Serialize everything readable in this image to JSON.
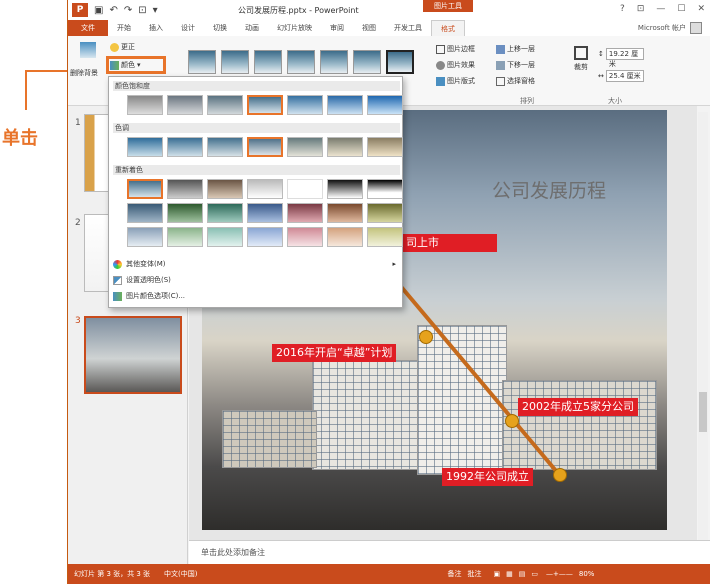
{
  "callout": {
    "label": "单击"
  },
  "titlebar": {
    "title": "公司发展历程.pptx - PowerPoint",
    "context_tab": "图片工具",
    "help": "?",
    "minimize": "—",
    "restore": "☐",
    "close": "✕"
  },
  "tabs": [
    "文件",
    "开始",
    "插入",
    "设计",
    "切换",
    "动画",
    "幻灯片放映",
    "审阅",
    "视图",
    "开发工具",
    "格式"
  ],
  "account": "Microsoft 帐户",
  "ribbon": {
    "remove_bg": "删除背景",
    "corrections": "更正",
    "color": "颜色",
    "picture_border": "图片边框",
    "picture_effects": "图片效果",
    "picture_layout": "图片版式",
    "bring_forward": "上移一层",
    "send_backward": "下移一层",
    "selection_pane": "选择窗格",
    "arrange_label": "排列",
    "crop": "裁剪",
    "height": "19.22 厘米",
    "width": "25.4 厘米",
    "size_label": "大小"
  },
  "dropdown": {
    "section_saturation": "颜色饱和度",
    "section_tone": "色调",
    "section_recolor": "重新着色",
    "more_variations": "其他变体(M)",
    "set_transparent": "设置透明色(S)",
    "color_options": "图片颜色选项(C)..."
  },
  "slides": [
    {
      "num": "1"
    },
    {
      "num": "2"
    },
    {
      "num": "3"
    }
  ],
  "slide": {
    "title": "公司发展历程",
    "labels": [
      "2016年开启“卓越”计划",
      "2002年成立5家分公司",
      "1992年公司成立",
      "司上市"
    ]
  },
  "notes": "单击此处添加备注",
  "status": {
    "slide_info": "幻灯片 第 3 张，共 3 张",
    "language": "中文(中国)",
    "notes_btn": "备注",
    "comments_btn": "批注",
    "zoom": "80%"
  }
}
